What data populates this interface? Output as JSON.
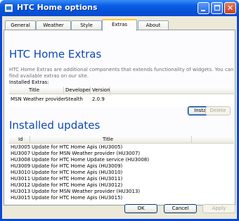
{
  "window": {
    "title": "HTC Home options"
  },
  "tabs": [
    {
      "label": "General"
    },
    {
      "label": "Weather"
    },
    {
      "label": "Style"
    },
    {
      "label": "Extras",
      "active": true
    },
    {
      "label": "About"
    }
  ],
  "extras": {
    "heading": "HTC Home Extras",
    "description": "HTC Home Extras are additional components that extends functionality of widgets. You can find available extras on our site.",
    "installed_label": "Installed Extras:",
    "columns": [
      "Title",
      "Developer",
      "Version"
    ],
    "rows": [
      {
        "title": "MSN Weather provider",
        "developer": "Stealth",
        "version": "2.0.9"
      }
    ],
    "install_button": "Install...",
    "delete_button": "Delete"
  },
  "updates": {
    "heading": "Installed updates",
    "columns": [
      "Id",
      "Title"
    ],
    "rows": [
      {
        "id": "HU3005",
        "title": "Update for HTC Home Apis (HU3005)"
      },
      {
        "id": "HU3007",
        "title": "Update for MSN Weather provider (HU3007)"
      },
      {
        "id": "HU3008",
        "title": "Update for HTC Home Update service (HU3008)"
      },
      {
        "id": "HU3009",
        "title": "Update for HTC Home Apis (HU3009)"
      },
      {
        "id": "HU3010",
        "title": "Update for HTC Home Apis (HU3010)"
      },
      {
        "id": "HU3011",
        "title": "Update for HTC Home Apis (HU3011)"
      },
      {
        "id": "HU3012",
        "title": "Update for HTC Home Apis (HU3012)"
      },
      {
        "id": "HU3013",
        "title": "Update for MSN Weather provider (HU3013)"
      },
      {
        "id": "HU3015",
        "title": "Update for HTC Home Apis (HU3015)"
      }
    ]
  },
  "footer": {
    "ok": "OK",
    "cancel": "Cancel",
    "apply": "Apply"
  }
}
